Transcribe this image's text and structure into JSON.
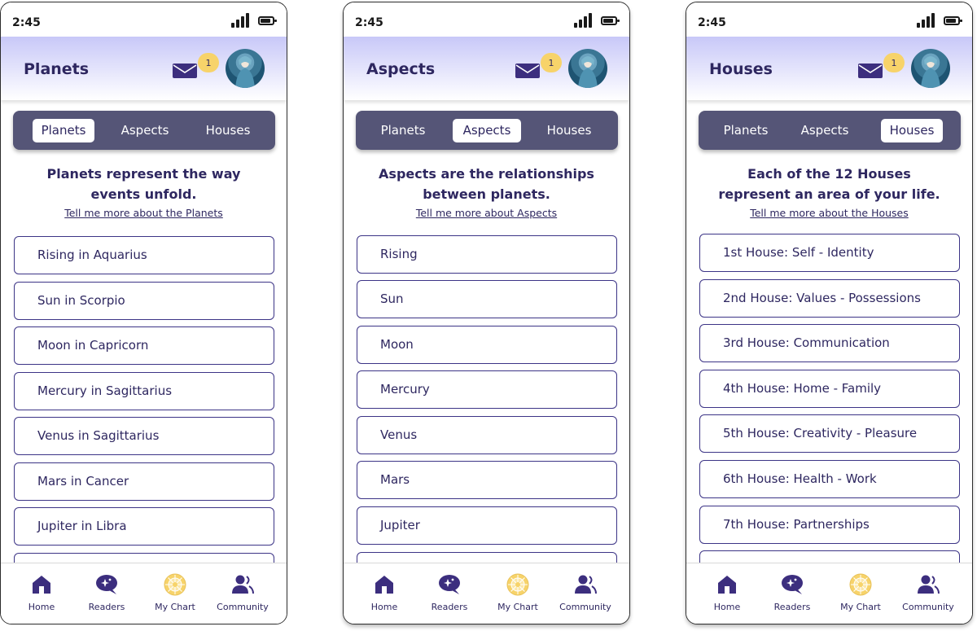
{
  "status": {
    "time": "2:45"
  },
  "badge_count": "1",
  "colors": {
    "accent": "#2e2760",
    "segment_bg": "#555577",
    "badge": "#f7d36a",
    "header_gradient_top": "#c8c8f8"
  },
  "tabs": {
    "planets": "Planets",
    "aspects": "Aspects",
    "houses": "Houses"
  },
  "nav": {
    "home": "Home",
    "readers": "Readers",
    "mychart": "My Chart",
    "community": "Community"
  },
  "icons": {
    "mail": "mail-icon",
    "avatar": "avatar",
    "home": "home-icon",
    "readers": "readers-chat-icon",
    "mychart": "chart-wheel-icon",
    "community": "community-icon",
    "signal": "signal-icon",
    "battery": "battery-icon"
  },
  "screens": [
    {
      "title": "Planets",
      "active_tab": "planets",
      "intro_line1": "Planets represent the way",
      "intro_line2": "events unfold.",
      "link": "Tell me more about the Planets",
      "items": [
        "Rising in Aquarius",
        "Sun in Scorpio",
        "Moon in Capricorn",
        "Mercury in Sagittarius",
        "Venus in Sagittarius",
        "Mars in Cancer",
        "Jupiter in Libra"
      ]
    },
    {
      "title": "Aspects",
      "active_tab": "aspects",
      "intro_line1": "Aspects are the relationships",
      "intro_line2": "between planets.",
      "link": "Tell me more about Aspects",
      "items": [
        "Rising",
        "Sun",
        "Moon",
        "Mercury",
        "Venus",
        "Mars",
        "Jupiter"
      ]
    },
    {
      "title": "Houses",
      "active_tab": "houses",
      "intro_line1": "Each of the 12 Houses",
      "intro_line2": "represent an area of your life.",
      "link": "Tell me more about the Houses",
      "items": [
        "1st House: Self - Identity",
        "2nd House: Values - Possessions",
        "3rd House: Communication",
        "4th House: Home - Family",
        "5th House: Creativity - Pleasure",
        "6th House: Health - Work",
        "7th House: Partnerships"
      ]
    }
  ]
}
